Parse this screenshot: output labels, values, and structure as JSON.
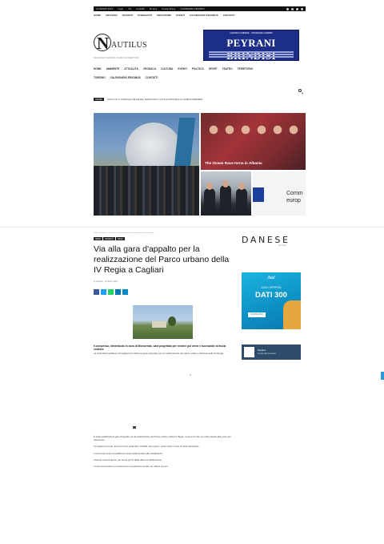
{
  "topbar": {
    "date": "21 MARZO 2023",
    "links": [
      "Login",
      "Chi",
      "Contatti",
      "Privacy",
      "Cookie Policy"
    ],
    "extra": "CALENDARIO ERASMUS"
  },
  "top_menu": [
    "HOME",
    "ARCHIVIO",
    "ISCRIVITI",
    "PUBBLICITÀ",
    "REDAZIONE",
    "EVENTI",
    "CALENDARIO ERASMUS",
    "CONTATTI"
  ],
  "site": {
    "logo_letter": "N",
    "logo_word": "AUTILUS",
    "tagline": "MAGAZINE DI CULTURA, SOCIETÀ E TERRITORIO"
  },
  "ad": {
    "top_line": "AGENZIA FUNEBRE · ONORANZE FUNEBRI",
    "name": "PEYRANI BRINDISI"
  },
  "nav": {
    "row1": [
      "HOME",
      "AMBIENTE",
      "ATTUALITÀ",
      "CRONACA",
      "CULTURA",
      "EVENTI",
      "POLITICA",
      "SPORT",
      "TEATRO",
      "TERRITORIO"
    ],
    "row2": [
      "TURISMO",
      "CALENDARIO ERASMUS",
      "CONTATTI"
    ]
  },
  "ticker": {
    "badge": "ULTIME",
    "text": "NAUTILUS: IL GIORNALE ONLINE DEL TERRITORIO, TUTTE LE NOTIZIE E GLI APPROFONDIMENTI"
  },
  "hero": {
    "top_right_caption": "The Ocean Race torna in Albania",
    "bottom_right_text1": "Comm",
    "bottom_right_text2": "europ"
  },
  "article": {
    "breadcrumb": "Home › Attualità › Via alla gara d'appalto per la realizzazione del Parco urbano",
    "tags": [
      "NEWS",
      "SOCIETÀ",
      "ITALIA"
    ],
    "title": "Via alla gara d'appalto per la realizzazione del Parco urbano della IV Regia a Cagliari",
    "meta": "by Nautilus · 21 March 2023",
    "lead": "Il complesso, dimenticato in zona di Monserrato, sarà progettato per rendere più verde e accessibile la fascia costiera.",
    "lead2": "La Città Metropolitana di Cagliari ha indetto la gara d'appalto per la realizzazione del parco urbano nell'area della IV Regia.",
    "body": [
      "È stata pubblicata la gara d'appalto per la realizzazione del Parco urbano della IV Regia, un'area di oltre sei ettari situata alle porte del capoluogo.",
      "Il progetto prevede nuovi percorsi pedonali e ciclabili, aree gioco, spazi verdi e zone di sosta attrezzate.",
      "L'intervento mira a riqualificare l'area restituendola alla cittadinanza.",
      "Il bando resterà aperto per trenta giorni dalla data di pubblicazione.",
      "L'ente ha previsto un investimento complessivo di oltre tre milioni di euro."
    ]
  },
  "sidebar": {
    "logo_word": "DANESE",
    "logo_sub": "EDITORE",
    "promo_brand": "iliad",
    "promo_line1": "CON L'OFFERTA",
    "promo_line2": "DATI 300",
    "promo_cta": "SCOPRI ORA",
    "banner_title": "Nautilus",
    "banner_sub": "Iscriviti alla newsletter"
  },
  "colors": {
    "accent": "#1c2e86",
    "share": [
      "#3b5998",
      "#1da1f2",
      "#25d366",
      "#0077b5",
      "#0088cc"
    ]
  }
}
